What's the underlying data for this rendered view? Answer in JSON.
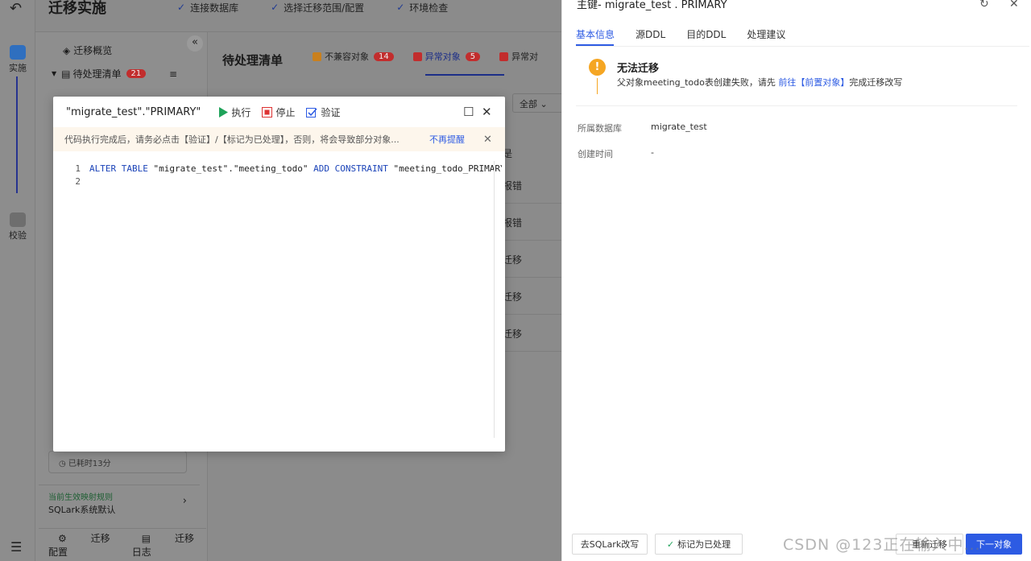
{
  "rail": {
    "back_icon": "back-arrow-icon",
    "items": [
      {
        "label": "实施",
        "icon": "database-icon",
        "color": "#2f7bd8"
      },
      {
        "label": "校验",
        "icon": "check-db-icon",
        "color": "#6e6e6e"
      }
    ],
    "menu_icon": "menu-icon"
  },
  "header": {
    "title": "迁移实施",
    "steps": [
      "连接数据库",
      "选择迁移范围/配置",
      "环境检查"
    ]
  },
  "left_panel": {
    "overview": "迁移概览",
    "pending": "待处理清单",
    "pending_count": "21",
    "rule_title": "当前生效映射规则",
    "rule_value": "SQLark系统默认",
    "elapsed": "已耗时13分",
    "bottom": [
      "迁移配置",
      "迁移日志"
    ]
  },
  "main": {
    "heading": "待处理清单",
    "tabs": [
      {
        "label": "不兼容对象",
        "count": "14",
        "color": "#c9801d"
      },
      {
        "label": "异常对象",
        "count": "5",
        "color": "#c22d2d",
        "active": true
      },
      {
        "label": "异常对",
        "count": "",
        "color": "#c22d2d"
      }
    ],
    "filter": "全部",
    "col_header": "是",
    "rows": [
      "报错",
      "报错",
      "迁移",
      "迁移",
      "迁移"
    ]
  },
  "modal": {
    "title": "\"migrate_test\".\"PRIMARY\"",
    "run": "执行",
    "stop": "停止",
    "verify": "验证",
    "notice": "代码执行完成后，请务必点击【验证】/【标记为已处理】，否则，将会导致部分对象...",
    "dismiss": "不再提醒",
    "lines": [
      "1",
      "2"
    ],
    "code_kw1": "ALTER TABLE",
    "code_s1": " \"migrate_test\".\"meeting_todo\" ",
    "code_kw2": "ADD CONSTRAINT",
    "code_s2": " \"meeting_todo_PRIMARY\" ",
    "code_kw3": "PR"
  },
  "drawer": {
    "title": "主键- migrate_test . PRIMARY",
    "tabs": [
      "基本信息",
      "源DDL",
      "目的DDL",
      "处理建议"
    ],
    "warn_title": "无法迁移",
    "warn_desc_pre": "父对象meeting_todo表创建失败，请先",
    "warn_link": " 前往【前置对象】",
    "warn_desc_post": "完成迁移改写",
    "fields": [
      {
        "label": "所属数据库",
        "value": "migrate_test"
      },
      {
        "label": "创建时间",
        "value": "-"
      }
    ],
    "buttons": {
      "sqlark": "去SQLark改写",
      "mark": "标记为已处理",
      "retry": "重新迁移",
      "next": "下一对象"
    }
  },
  "watermark": "CSDN @123正在输入中..."
}
